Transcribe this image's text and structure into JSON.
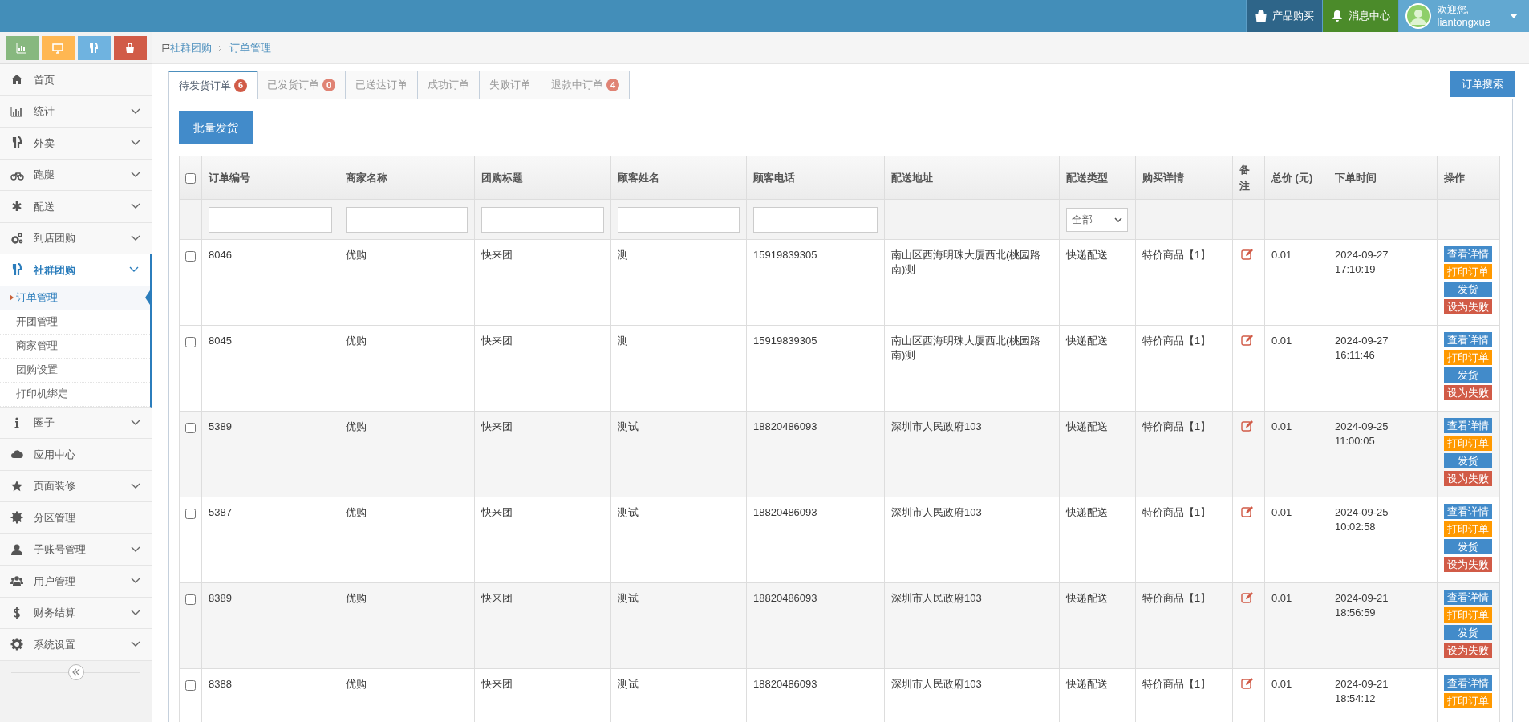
{
  "top_bar": {
    "buttons": [
      {
        "kind": "buy",
        "label": "产品购买"
      },
      {
        "kind": "messages",
        "label": "消息中心"
      }
    ],
    "user": {
      "greeting": "欢迎您,",
      "name": "liantongxue"
    }
  },
  "sidebar": {
    "items": [
      {
        "label": "首页",
        "expandable": false,
        "selected": false
      },
      {
        "label": "统计",
        "expandable": true,
        "selected": false
      },
      {
        "label": "外卖",
        "expandable": true,
        "selected": false
      },
      {
        "label": "跑腿",
        "expandable": true,
        "selected": false
      },
      {
        "label": "配送",
        "expandable": true,
        "selected": false
      },
      {
        "label": "到店团购",
        "expandable": true,
        "selected": false
      },
      {
        "label": "社群团购",
        "expandable": true,
        "selected": true,
        "children": [
          {
            "label": "订单管理",
            "selected": true
          },
          {
            "label": "开团管理",
            "selected": false
          },
          {
            "label": "商家管理",
            "selected": false
          },
          {
            "label": "团购设置",
            "selected": false
          },
          {
            "label": "打印机绑定",
            "selected": false
          }
        ]
      },
      {
        "label": "圈子",
        "expandable": true,
        "selected": false
      },
      {
        "label": "应用中心",
        "expandable": false,
        "selected": false
      },
      {
        "label": "页面装修",
        "expandable": true,
        "selected": false
      },
      {
        "label": "分区管理",
        "expandable": false,
        "selected": false
      },
      {
        "label": "子账号管理",
        "expandable": true,
        "selected": false
      },
      {
        "label": "用户管理",
        "expandable": true,
        "selected": false
      },
      {
        "label": "财务结算",
        "expandable": true,
        "selected": false
      },
      {
        "label": "系统设置",
        "expandable": true,
        "selected": false
      }
    ]
  },
  "breadcrumb": [
    "社群团购",
    "订单管理"
  ],
  "tabs": [
    {
      "label": "待发货订单",
      "badge": "6",
      "selected": true
    },
    {
      "label": "已发货订单",
      "badge": "0",
      "selected": false
    },
    {
      "label": "已送达订单",
      "selected": false
    },
    {
      "label": "成功订单",
      "selected": false
    },
    {
      "label": "失败订单",
      "selected": false
    },
    {
      "label": "退款中订单",
      "badge": "4",
      "selected": false
    }
  ],
  "search_button": "订单搜索",
  "batch_button": "批量发货",
  "table": {
    "select_all_checked": false,
    "columns": [
      {
        "label": "订单编号",
        "filter": {
          "kind": "input"
        }
      },
      {
        "label": "商家名称",
        "filter": {
          "kind": "input"
        }
      },
      {
        "label": "团购标题",
        "filter": {
          "kind": "input"
        }
      },
      {
        "label": "顾客姓名",
        "filter": {
          "kind": "input"
        }
      },
      {
        "label": "顾客电话",
        "filter": {
          "kind": "input"
        }
      },
      {
        "label": "配送地址"
      },
      {
        "label": "配送类型",
        "filter": {
          "kind": "select",
          "value": "全部"
        }
      },
      {
        "label": "购买详情"
      },
      {
        "label": "备注"
      },
      {
        "label": "总价 (元)"
      },
      {
        "label": "下单时间"
      },
      {
        "label": "操作"
      }
    ],
    "rows": [
      {
        "checked": false,
        "id": "8046",
        "merchant": "优购",
        "title": "快来团",
        "customer": "测",
        "phone": "15919839305",
        "address": "南山区西海明珠大厦西北(桃园路南)测",
        "delivery": "快递配送",
        "detail": "特价商品【1】",
        "total": "0.01",
        "date": "2024-09-27",
        "time": "17:10:19",
        "actions": [
          {
            "kind": "view",
            "label": "查看详情"
          },
          {
            "kind": "print",
            "label": "打印订单"
          },
          {
            "kind": "ship",
            "label": "发货"
          },
          {
            "kind": "fail",
            "label": "设为失败"
          }
        ]
      },
      {
        "checked": false,
        "id": "8045",
        "merchant": "优购",
        "title": "快来团",
        "customer": "测",
        "phone": "15919839305",
        "address": "南山区西海明珠大厦西北(桃园路南)测",
        "delivery": "快递配送",
        "detail": "特价商品【1】",
        "total": "0.01",
        "date": "2024-09-27",
        "time": "16:11:46",
        "actions": [
          {
            "kind": "view",
            "label": "查看详情"
          },
          {
            "kind": "print",
            "label": "打印订单"
          },
          {
            "kind": "ship",
            "label": "发货"
          },
          {
            "kind": "fail",
            "label": "设为失败"
          }
        ]
      },
      {
        "checked": false,
        "id": "5389",
        "merchant": "优购",
        "title": "快来团",
        "customer": "测试",
        "phone": "18820486093",
        "address": "深圳市人民政府103",
        "delivery": "快递配送",
        "detail": "特价商品【1】",
        "total": "0.01",
        "date": "2024-09-25",
        "time": "11:00:05",
        "actions": [
          {
            "kind": "view",
            "label": "查看详情"
          },
          {
            "kind": "print",
            "label": "打印订单"
          },
          {
            "kind": "ship",
            "label": "发货"
          },
          {
            "kind": "fail",
            "label": "设为失败"
          }
        ]
      },
      {
        "checked": false,
        "id": "5387",
        "merchant": "优购",
        "title": "快来团",
        "customer": "测试",
        "phone": "18820486093",
        "address": "深圳市人民政府103",
        "delivery": "快递配送",
        "detail": "特价商品【1】",
        "total": "0.01",
        "date": "2024-09-25",
        "time": "10:02:58",
        "actions": [
          {
            "kind": "view",
            "label": "查看详情"
          },
          {
            "kind": "print",
            "label": "打印订单"
          },
          {
            "kind": "ship",
            "label": "发货"
          },
          {
            "kind": "fail",
            "label": "设为失败"
          }
        ]
      },
      {
        "checked": false,
        "id": "8389",
        "merchant": "优购",
        "title": "快来团",
        "customer": "测试",
        "phone": "18820486093",
        "address": "深圳市人民政府103",
        "delivery": "快递配送",
        "detail": "特价商品【1】",
        "total": "0.01",
        "date": "2024-09-21",
        "time": "18:56:59",
        "actions": [
          {
            "kind": "view",
            "label": "查看详情"
          },
          {
            "kind": "print",
            "label": "打印订单"
          },
          {
            "kind": "ship",
            "label": "发货"
          },
          {
            "kind": "fail",
            "label": "设为失败"
          }
        ]
      },
      {
        "checked": false,
        "id": "8388",
        "merchant": "优购",
        "title": "快来团",
        "customer": "测试",
        "phone": "18820486093",
        "address": "深圳市人民政府103",
        "delivery": "快递配送",
        "detail": "特价商品【1】",
        "total": "0.01",
        "date": "2024-09-21",
        "time": "18:54:12",
        "actions": [
          {
            "kind": "view",
            "label": "查看详情"
          },
          {
            "kind": "print",
            "label": "打印订单"
          }
        ]
      }
    ]
  }
}
